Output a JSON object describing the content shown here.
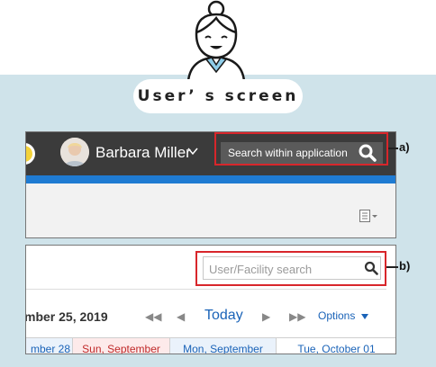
{
  "caption": {
    "label": "User’ s screen"
  },
  "header": {
    "user_name": "Barbara Miller",
    "search_text": "Search within application"
  },
  "callouts": {
    "a": "a)",
    "b": "b)"
  },
  "scheduler": {
    "search_placeholder": "User/Facility search",
    "date_heading": "mber 25, 2019",
    "nav": {
      "prev_week": "◀◀",
      "prev_day": "◀",
      "today": "Today",
      "next_day": "▶",
      "next_week": "▶▶",
      "options": "Options"
    },
    "days": [
      {
        "label": "mber 28"
      },
      {
        "label": "Sun, September"
      },
      {
        "label": "Mon, September"
      },
      {
        "label": "Tue, October 01"
      }
    ]
  },
  "colors": {
    "accent_red": "#d8262b",
    "brand_blue": "#1f7bd2",
    "link_blue": "#1a63b8",
    "topbar": "#3b3b3b",
    "background": "#cfe3ea"
  },
  "icons": {
    "figure": "person-icon",
    "app_search": "search-icon",
    "facility_search": "search-icon",
    "menu": "list-menu-icon",
    "chevron": "chevron-down-icon"
  }
}
